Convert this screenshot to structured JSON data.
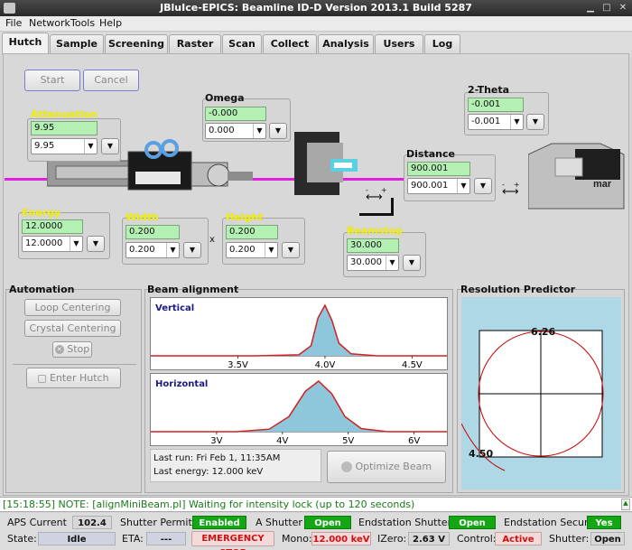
{
  "window": {
    "title": "JBluIce-EPICS: Beamline ID-D Version 2013.1 Build 5287"
  },
  "menu": [
    "File",
    "Network",
    "Tools",
    "Help"
  ],
  "tabs": [
    "Hutch",
    "Sample",
    "Screening",
    "Raster",
    "Scan",
    "Collect",
    "Analysis",
    "Users",
    "Log"
  ],
  "hutch": {
    "start_label": "Start",
    "cancel_label": "Cancel",
    "attenuation": {
      "label": "Attenuation",
      "value": "9.95",
      "combo": "9.95"
    },
    "omega": {
      "label": "Omega",
      "value": "-0.000",
      "combo": "0.000"
    },
    "two_theta": {
      "label": "2-Theta",
      "value": "-0.001",
      "combo": "-0.001"
    },
    "distance": {
      "label": "Distance",
      "value": "900.001",
      "combo": "900.001"
    },
    "energy": {
      "label": "Energy",
      "value": "12.0000",
      "combo": "12.0000"
    },
    "width": {
      "label": "Width",
      "value": "0.200",
      "combo": "0.200"
    },
    "height": {
      "label": "Height",
      "value": "0.200",
      "combo": "0.200"
    },
    "x_sep": "x",
    "beamstop": {
      "label": "Beamstop",
      "value": "30.000",
      "combo": "30.000"
    },
    "detector_brand": "mar",
    "arrow_minus": "-",
    "arrow_plus": "+"
  },
  "automation": {
    "title": "Automation",
    "loop_centering": "Loop Centering",
    "crystal_centering": "Crystal Centering",
    "stop": "Stop",
    "enter_hutch": "Enter Hutch"
  },
  "beam_alignment": {
    "title": "Beam alignment",
    "last_run": "Last run: Fri Feb 1, 11:35AM",
    "last_energy": "Last energy: 12.000 keV",
    "optimize_label": "Optimize Beam"
  },
  "chart_data": [
    {
      "type": "area",
      "title": "Vertical",
      "x_ticks": [
        "3.5V",
        "4.0V",
        "4.5V"
      ],
      "xlim": [
        3.0,
        4.7
      ],
      "x": [
        3.0,
        3.6,
        3.85,
        3.92,
        3.96,
        4.0,
        4.04,
        4.08,
        4.15,
        4.3,
        4.7
      ],
      "y": [
        0.0,
        0.0,
        0.02,
        0.2,
        0.75,
        1.0,
        0.7,
        0.25,
        0.04,
        0.0,
        0.0
      ],
      "color": "#d02020",
      "fill": "#8ec6dc"
    },
    {
      "type": "area",
      "title": "Horizontal",
      "x_ticks": [
        "3V",
        "4V",
        "5V",
        "6V"
      ],
      "xlim": [
        2.0,
        6.5
      ],
      "x": [
        2.0,
        3.3,
        3.8,
        4.1,
        4.35,
        4.55,
        4.75,
        4.95,
        5.2,
        5.6,
        6.5
      ],
      "y": [
        0.0,
        0.0,
        0.05,
        0.3,
        0.8,
        1.0,
        0.75,
        0.3,
        0.06,
        0.0,
        0.0
      ],
      "color": "#d02020",
      "fill": "#8ec6dc"
    },
    {
      "type": "scatter",
      "title": "Resolution Predictor",
      "labels": [
        "6.26",
        "4.50"
      ]
    }
  ],
  "log": {
    "text": "[15:18:55] NOTE: [alignMiniBeam.pl] Waiting for intensity lock (up to 120 seconds)"
  },
  "status": {
    "aps_current_label": "APS Current",
    "aps_current": "102.4",
    "shutter_permit_label": "Shutter Permit",
    "shutter_permit": "Enabled",
    "a_shutter_label": "A Shutter",
    "a_shutter": "Open",
    "endstation_shutter_label": "Endstation Shutter",
    "endstation_shutter": "Open",
    "endstation_secure_label": "Endstation Secure",
    "endstation_secure": "Yes",
    "state_label": "State:",
    "state": "Idle",
    "eta_label": "ETA:",
    "eta": "---",
    "emergency_stop": "EMERGENCY STOP",
    "mono_label": "Mono:",
    "mono": "12.000 keV",
    "izero_label": "IZero:",
    "izero": "2.63 V",
    "control_label": "Control:",
    "control": "Active",
    "shutter_label": "Shutter:",
    "shutter": "Open"
  },
  "colors": {
    "beam": "#e020e0",
    "log_text": "#1a7a1a",
    "status_green": "#13a813"
  }
}
